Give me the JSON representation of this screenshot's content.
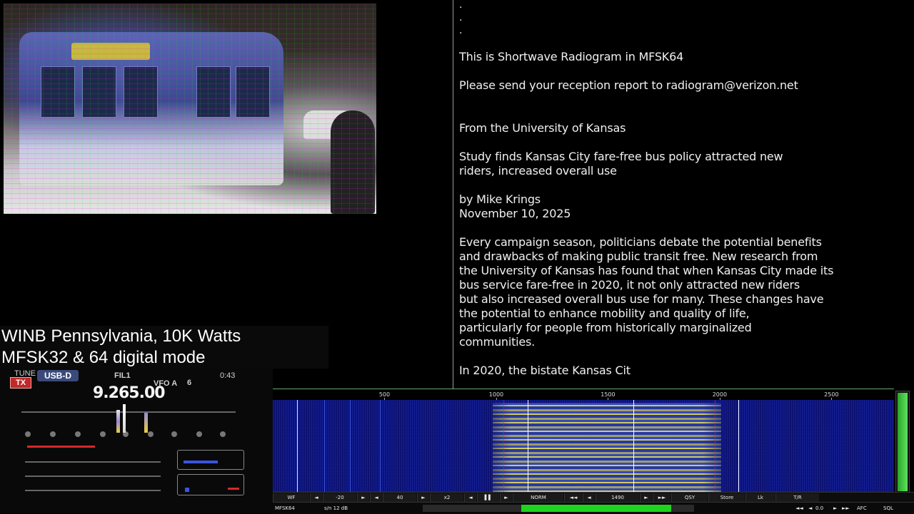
{
  "message": {
    "dots": [
      ".",
      ".",
      "."
    ],
    "lines": [
      "This is Shortwave Radiogram in MFSK64",
      "",
      "Please send your reception report to radiogram@verizon.net",
      "",
      "",
      "From the University of Kansas",
      "",
      "Study finds Kansas City fare-free bus policy attracted new",
      "riders, increased overall use",
      "",
      "by Mike Krings",
      "November 10, 2025",
      "",
      "Every campaign season, politicians debate the potential benefits",
      "and drawbacks of making public transit free. New research from",
      "the University of Kansas has found that when Kansas City made its",
      "bus service fare-free in 2020, it not only attracted new riders",
      "but also increased overall bus use for many. These changes have",
      "the potential to enhance mobility and quality of life,",
      "particularly for people from historically marginalized",
      "communities.",
      "",
      "In 2020, the bistate Kansas Cit"
    ]
  },
  "caption": {
    "line1": "WINB Pennsylvania, 10K Watts",
    "line2": "MFSK32 & 64 digital mode"
  },
  "radio": {
    "tune": "TUNE",
    "tx": "TX",
    "mode": "USB-D",
    "filter": "FIL1",
    "vfo": "VFO A",
    "vfo_num": "6",
    "timer": "0:43",
    "frequency": "9.265.00"
  },
  "waterfall": {
    "scale_ticks": [
      "500",
      "1000",
      "1500",
      "2000",
      "2500"
    ]
  },
  "controls": [
    {
      "label": "WF"
    },
    {
      "label": "◄"
    },
    {
      "label": "-20"
    },
    {
      "label": "►"
    },
    {
      "label": "◄"
    },
    {
      "label": "40"
    },
    {
      "label": "►"
    },
    {
      "label": "x2"
    },
    {
      "label": "◄"
    },
    {
      "label": "▌▌"
    },
    {
      "label": "►"
    },
    {
      "label": "NORM"
    },
    {
      "label": "◄◄"
    },
    {
      "label": "◄"
    },
    {
      "label": "1490"
    },
    {
      "label": "►"
    },
    {
      "label": "►►"
    },
    {
      "label": "QSY"
    },
    {
      "label": "Store"
    },
    {
      "label": "Lk"
    },
    {
      "label": "T/R"
    }
  ],
  "status": {
    "mode": "MFSK64",
    "sn": "s/n  12 dB",
    "value": "0.0",
    "afc": "AFC",
    "sql": "SQL"
  },
  "colors": {
    "waterfall_bg": "#0a0f6a",
    "signal": "#e8e060",
    "meter_green": "#1fd41f",
    "tx_red": "#c0282a"
  }
}
